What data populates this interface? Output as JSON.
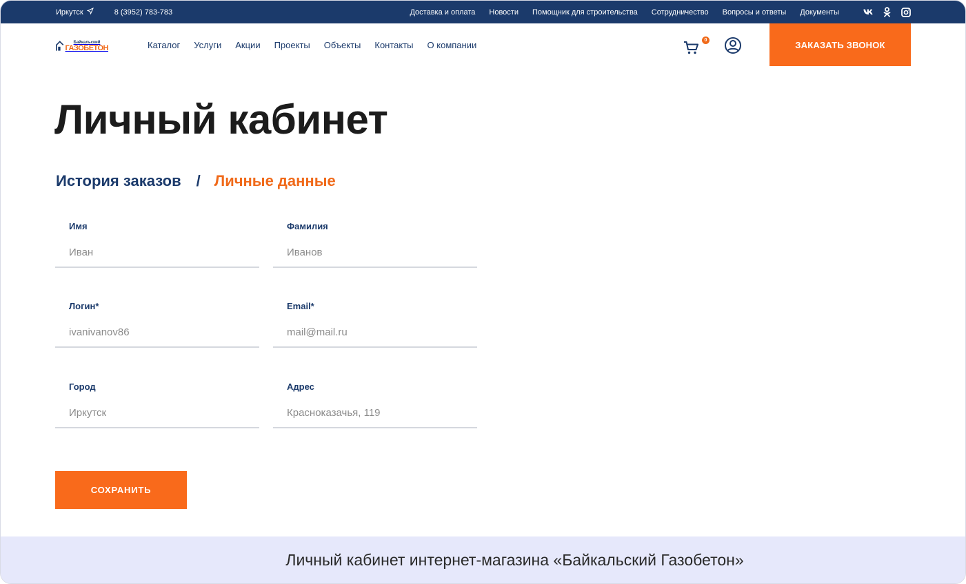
{
  "topbar": {
    "city": "Иркутск",
    "phone": "8 (3952) 783-783",
    "links": [
      "Доставка и оплата",
      "Новости",
      "Помощник для строительства",
      "Сотрудничество",
      "Вопросы и ответы",
      "Документы"
    ],
    "social": [
      "vk-icon",
      "odnoklassniki-icon",
      "instagram-icon"
    ]
  },
  "header": {
    "logo_small": "Байкальский",
    "logo_big": "ГАЗОБЕТОН",
    "nav": [
      "Каталог",
      "Услуги",
      "Акции",
      "Проекты",
      "Объекты",
      "Контакты",
      "О компании"
    ],
    "cart_count": "0",
    "call_button": "ЗАКАЗАТЬ ЗВОНОК"
  },
  "page": {
    "title": "Личный кабинет",
    "tab_history": "История заказов",
    "tab_separator": "/",
    "tab_personal": "Личные данные"
  },
  "form": {
    "first_name": {
      "label": "Имя",
      "value": "Иван"
    },
    "last_name": {
      "label": "Фамилия",
      "value": "Иванов"
    },
    "login": {
      "label": "Логин*",
      "value": "ivanivanov86"
    },
    "email": {
      "label": "Email*",
      "value": "mail@mail.ru"
    },
    "city": {
      "label": "Город",
      "value": "Иркутск"
    },
    "address": {
      "label": "Адрес",
      "value": "Красноказачья, 119"
    },
    "save": "СОХРАНИТЬ"
  },
  "caption": "Личный кабинет интернет-магазина «Байкальский Газобетон»",
  "colors": {
    "navy": "#1b3a6b",
    "accent": "#f96a1b",
    "caption_bg": "#e6e8fb"
  }
}
